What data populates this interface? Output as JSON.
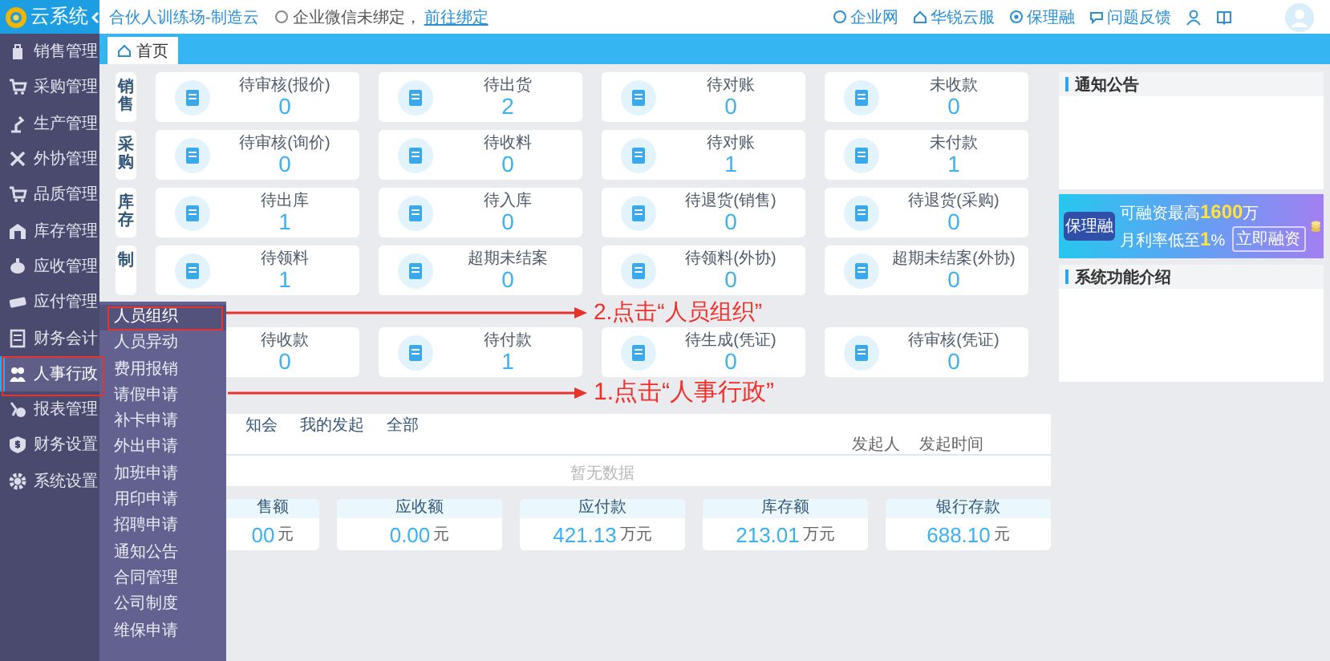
{
  "app": {
    "name": "云系统"
  },
  "header": {
    "title": "合伙人训练场-制造云",
    "notice": "企业微信未绑定，",
    "notice_link": "前往绑定",
    "links": [
      {
        "label": "企业网"
      },
      {
        "label": "华锐云服"
      },
      {
        "label": "保理融"
      },
      {
        "label": "问题反馈"
      }
    ]
  },
  "tabs": [
    {
      "label": "首页",
      "selected": true
    }
  ],
  "sidebar": {
    "items": [
      {
        "label": "销售管理",
        "selected": false
      },
      {
        "label": "采购管理",
        "selected": false
      },
      {
        "label": "生产管理",
        "selected": false
      },
      {
        "label": "外协管理",
        "selected": false
      },
      {
        "label": "品质管理",
        "selected": false
      },
      {
        "label": "库存管理",
        "selected": false
      },
      {
        "label": "应收管理",
        "selected": false
      },
      {
        "label": "应付管理",
        "selected": false
      },
      {
        "label": "财务会计",
        "selected": false
      },
      {
        "label": "人事行政",
        "selected": true
      },
      {
        "label": "报表管理",
        "selected": false
      },
      {
        "label": "财务设置",
        "selected": false
      },
      {
        "label": "系统设置",
        "selected": false
      }
    ]
  },
  "submenu": {
    "items": [
      {
        "label": "人员组织",
        "selected": true
      },
      {
        "label": "人员异动",
        "selected": false
      },
      {
        "label": "费用报销",
        "selected": false
      },
      {
        "label": "请假申请",
        "selected": false
      },
      {
        "label": "补卡申请",
        "selected": false
      },
      {
        "label": "外出申请",
        "selected": false
      },
      {
        "label": "加班申请",
        "selected": false
      },
      {
        "label": "用印申请",
        "selected": false
      },
      {
        "label": "招聘申请",
        "selected": false
      },
      {
        "label": "通知公告",
        "selected": false
      },
      {
        "label": "合同管理",
        "selected": false
      },
      {
        "label": "公司制度",
        "selected": false
      },
      {
        "label": "维保申请",
        "selected": false
      }
    ]
  },
  "dashboard": {
    "groups": [
      {
        "label": "销售",
        "cards": [
          {
            "title": "待审核(报价)",
            "value": "0"
          },
          {
            "title": "待出货",
            "value": "2"
          },
          {
            "title": "待对账",
            "value": "0"
          },
          {
            "title": "未收款",
            "value": "0"
          }
        ]
      },
      {
        "label": "采购",
        "cards": [
          {
            "title": "待审核(询价)",
            "value": "0"
          },
          {
            "title": "待收料",
            "value": "0"
          },
          {
            "title": "待对账",
            "value": "1"
          },
          {
            "title": "未付款",
            "value": "1"
          }
        ]
      },
      {
        "label": "库存",
        "cards": [
          {
            "title": "待出库",
            "value": "1"
          },
          {
            "title": "待入库",
            "value": "0"
          },
          {
            "title": "待退货(销售)",
            "value": "0"
          },
          {
            "title": "待退货(采购)",
            "value": "0"
          }
        ]
      },
      {
        "label": "制",
        "cards": [
          {
            "title": "待领料",
            "value": "1"
          },
          {
            "title": "超期未结案",
            "value": "0"
          },
          {
            "title": "待领料(外协)",
            "value": "0"
          },
          {
            "title": "超期未结案(外协)",
            "value": "0"
          }
        ]
      },
      {
        "cards": [
          {
            "title": "待收款",
            "value": "0"
          },
          {
            "title": "待付款",
            "value": "1"
          },
          {
            "title": "待生成(凭证)",
            "value": "0"
          },
          {
            "title": "待审核(凭证)",
            "value": "0"
          }
        ]
      }
    ]
  },
  "tasks": {
    "tabs": [
      {
        "label": "知会",
        "selected": false
      },
      {
        "label": "我的发起",
        "selected": false
      },
      {
        "label": "全部",
        "selected": false
      }
    ],
    "columns": [
      "发起人",
      "发起时间"
    ],
    "empty_text": "暂无数据"
  },
  "stats": [
    {
      "label": "售额",
      "value": "00",
      "unit": "元"
    },
    {
      "label": "应收额",
      "value": "0.00",
      "unit": "元"
    },
    {
      "label": "应付款",
      "value": "421.13",
      "unit": "万元"
    },
    {
      "label": "库存额",
      "value": "213.01",
      "unit": "万元"
    },
    {
      "label": "银行存款",
      "value": "688.10",
      "unit": "元"
    }
  ],
  "right_panel": {
    "notice_title": "通知公告",
    "banner": {
      "badge": "保理融",
      "line1": "可融资最高**1600**万",
      "line2": "月利率低至**1**%",
      "button": "立即融资"
    },
    "intro_title": "系统功能介绍"
  },
  "annotations": [
    {
      "text": "2.点击“人员组织”"
    },
    {
      "text": "1.点击“人事行政”"
    }
  ]
}
